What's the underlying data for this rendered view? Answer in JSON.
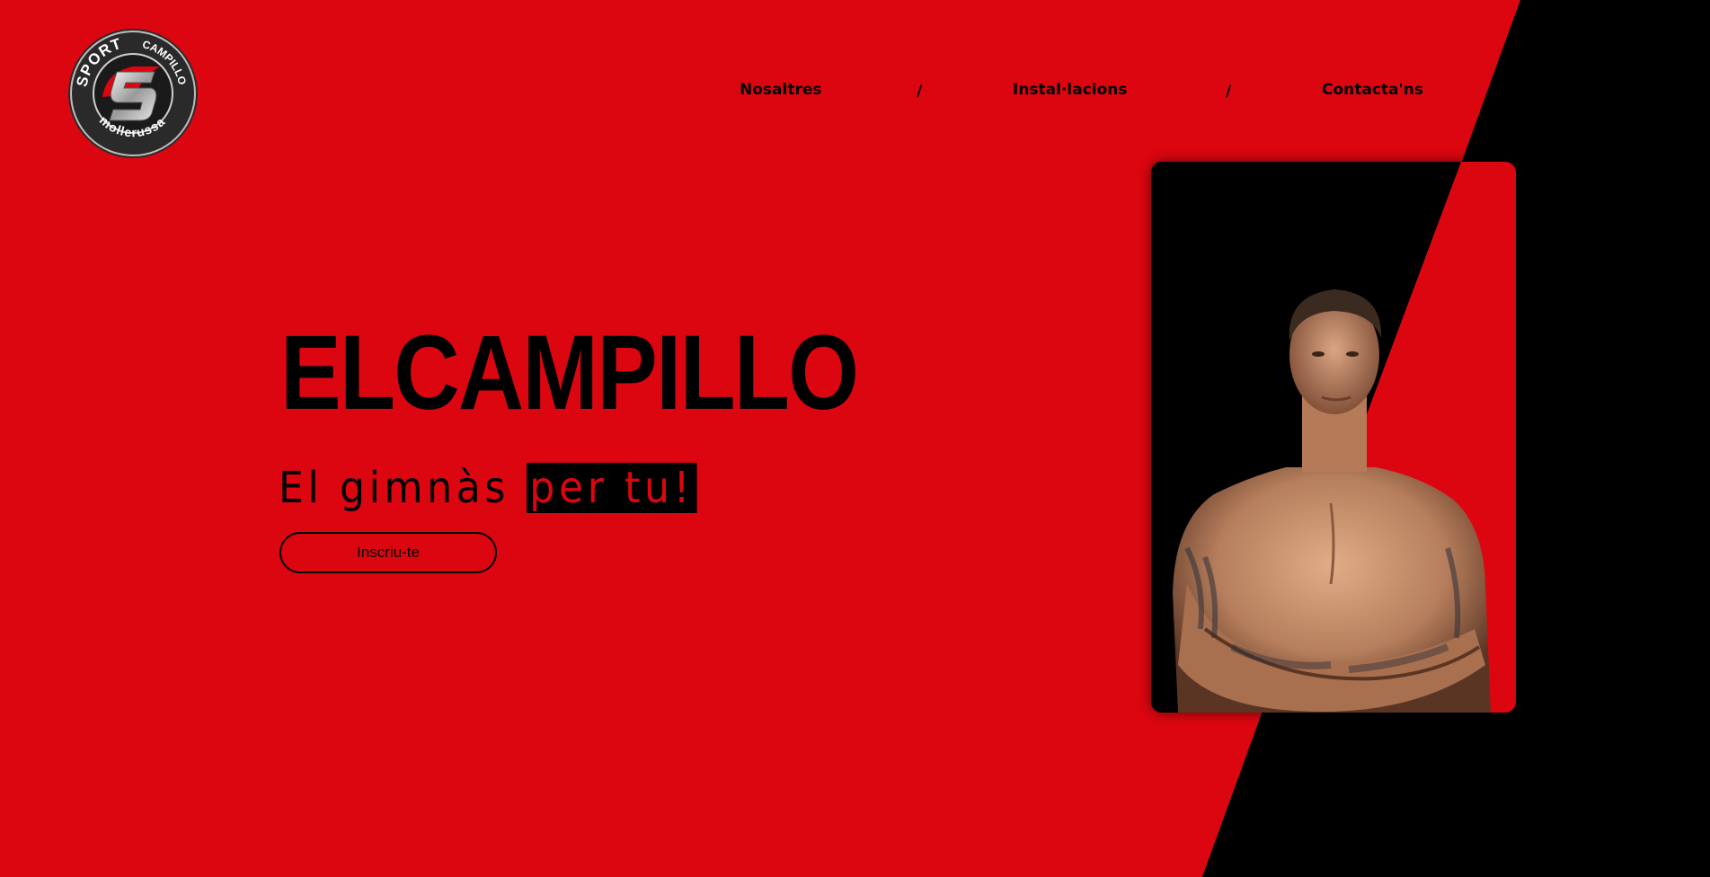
{
  "logo": {
    "word_sport": "SPORT",
    "word_campillo": "CAMPILLO",
    "word_city": "mollerussa"
  },
  "nav": {
    "items": [
      {
        "label": "Nosaltres"
      },
      {
        "label": "Instal·lacions"
      },
      {
        "label": "Contacta'ns"
      }
    ],
    "separator": "/"
  },
  "hero": {
    "title": "ELCAMPILLO",
    "subtitle_plain": "El gimnàs",
    "subtitle_highlight": "per tu!",
    "cta_label": "Inscriu-te"
  },
  "colors": {
    "brand_red": "#dc0610",
    "black": "#000000"
  },
  "icons": {
    "logo": "sport-campillo-logo",
    "photo": "athlete-photo"
  }
}
